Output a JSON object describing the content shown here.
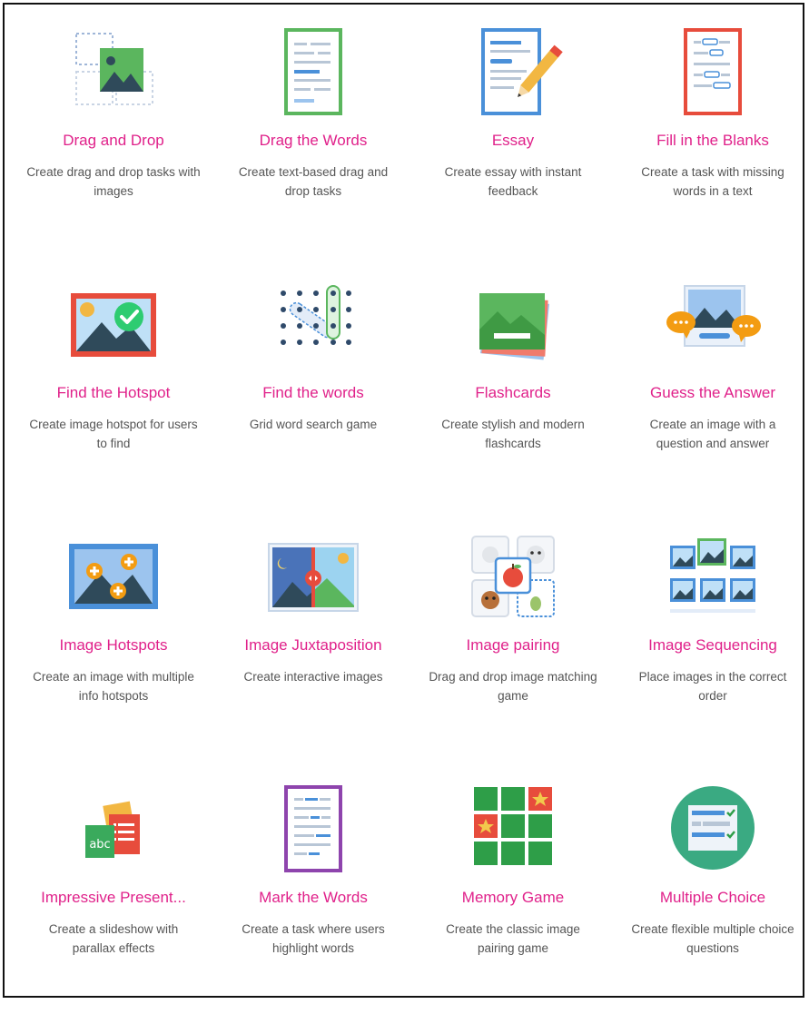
{
  "colors": {
    "title": "#e0218a",
    "desc": "#555555"
  },
  "items": [
    {
      "title": "Drag and Drop",
      "desc": "Create drag and drop tasks with images",
      "icon": "drag-drop-icon"
    },
    {
      "title": "Drag the Words",
      "desc": "Create text-based drag and drop tasks",
      "icon": "drag-words-icon"
    },
    {
      "title": "Essay",
      "desc": "Create essay with instant feedback",
      "icon": "essay-icon"
    },
    {
      "title": "Fill in the Blanks",
      "desc": "Create a task with missing words in a text",
      "icon": "fill-blanks-icon"
    },
    {
      "title": "Find the Hotspot",
      "desc": "Create image hotspot for users to find",
      "icon": "find-hotspot-icon"
    },
    {
      "title": "Find the words",
      "desc": "Grid word search game",
      "icon": "word-search-icon"
    },
    {
      "title": "Flashcards",
      "desc": "Create stylish and modern flashcards",
      "icon": "flashcards-icon"
    },
    {
      "title": "Guess the Answer",
      "desc": "Create an image with a question and answer",
      "icon": "guess-answer-icon"
    },
    {
      "title": "Image Hotspots",
      "desc": "Create an image with multiple info hotspots",
      "icon": "image-hotspots-icon"
    },
    {
      "title": "Image Juxtaposition",
      "desc": "Create interactive images",
      "icon": "image-juxtaposition-icon"
    },
    {
      "title": "Image pairing",
      "desc": "Drag and drop image matching game",
      "icon": "image-pairing-icon"
    },
    {
      "title": "Image Sequencing",
      "desc": "Place images in the correct order",
      "icon": "image-sequencing-icon"
    },
    {
      "title": "Impressive Present...",
      "desc": "Create a slideshow with parallax effects",
      "icon": "presentation-icon"
    },
    {
      "title": "Mark the Words",
      "desc": "Create a task where users highlight words",
      "icon": "mark-words-icon"
    },
    {
      "title": "Memory Game",
      "desc": "Create the classic image pairing game",
      "icon": "memory-game-icon"
    },
    {
      "title": "Multiple Choice",
      "desc": "Create flexible multiple choice questions",
      "icon": "multiple-choice-icon"
    }
  ]
}
